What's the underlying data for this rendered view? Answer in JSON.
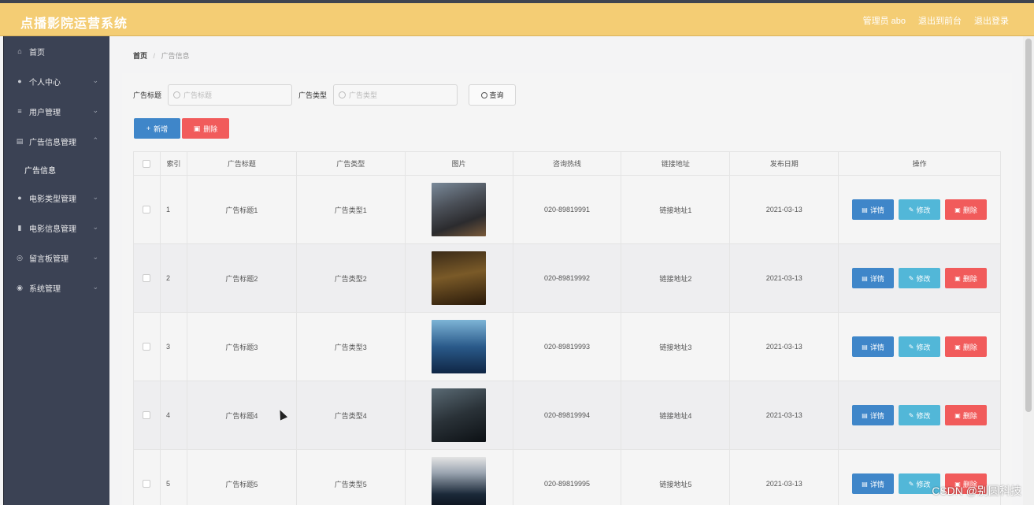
{
  "app": {
    "title": "点播影院运营系统",
    "user_label": "管理员 abo",
    "back_to_front": "退出到前台",
    "logout": "退出登录"
  },
  "sidebar": {
    "items": [
      {
        "label": "首页",
        "icon": "home-icon"
      },
      {
        "label": "个人中心",
        "icon": "user-icon"
      },
      {
        "label": "用户管理",
        "icon": "list-icon"
      },
      {
        "label": "广告信息管理",
        "icon": "briefcase-icon",
        "expanded": true
      },
      {
        "label": "电影类型管理",
        "icon": "user-icon"
      },
      {
        "label": "电影信息管理",
        "icon": "bar-icon"
      },
      {
        "label": "留言板管理",
        "icon": "globe-icon"
      },
      {
        "label": "系统管理",
        "icon": "mic-icon"
      }
    ],
    "subitem": "广告信息"
  },
  "breadcrumb": {
    "home": "首页",
    "separator": "/",
    "current": "广告信息"
  },
  "search": {
    "title_label": "广告标题",
    "title_placeholder": "广告标题",
    "type_label": "广告类型",
    "type_placeholder": "广告类型",
    "query_button": "查询"
  },
  "actions": {
    "add": "新增",
    "delete": "删除"
  },
  "table": {
    "headers": [
      "索引",
      "广告标题",
      "广告类型",
      "图片",
      "咨询热线",
      "链接地址",
      "发布日期",
      "操作"
    ],
    "rows": [
      {
        "index": "1",
        "title": "广告标题1",
        "type": "广告类型1",
        "phone": "020-89819991",
        "link": "链接地址1",
        "date": "2021-03-13"
      },
      {
        "index": "2",
        "title": "广告标题2",
        "type": "广告类型2",
        "phone": "020-89819992",
        "link": "链接地址2",
        "date": "2021-03-13"
      },
      {
        "index": "3",
        "title": "广告标题3",
        "type": "广告类型3",
        "phone": "020-89819993",
        "link": "链接地址3",
        "date": "2021-03-13"
      },
      {
        "index": "4",
        "title": "广告标题4",
        "type": "广告类型4",
        "phone": "020-89819994",
        "link": "链接地址4",
        "date": "2021-03-13"
      },
      {
        "index": "5",
        "title": "广告标题5",
        "type": "广告类型5",
        "phone": "020-89819995",
        "link": "链接地址5",
        "date": "2021-03-13"
      }
    ],
    "row_actions": {
      "detail": "详情",
      "edit": "修改",
      "delete": "删除"
    }
  },
  "watermark": "CSDN @别圆科技",
  "colors": {
    "topbar": "#f4cd74",
    "sidebar": "#3b4254",
    "primary": "#3f86c9",
    "info": "#52b7d8",
    "danger": "#f15b5b"
  }
}
